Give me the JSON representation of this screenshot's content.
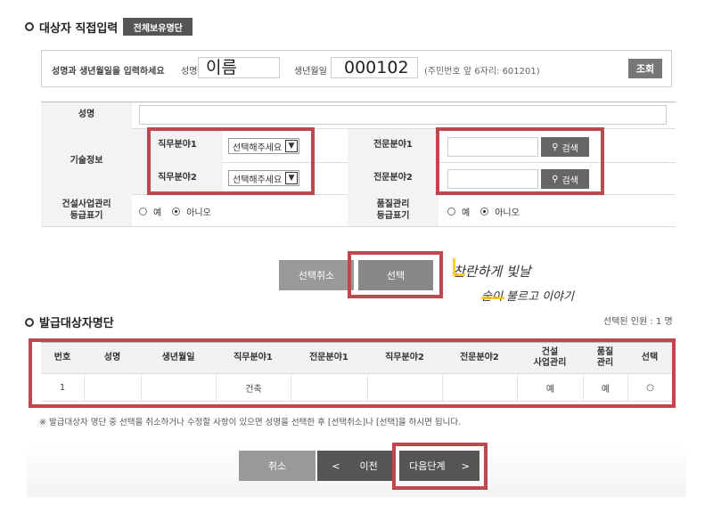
{
  "direct_input": {
    "section_title": "대상자 직접입력",
    "all_holders_button": "전체보유명단"
  },
  "lookup": {
    "prompt": "성명과 생년월일을 입력하세요",
    "name_label": "성명",
    "name_value": "이름",
    "birth_label": "생년월일",
    "birth_value": "000102",
    "birth_hint": "(주민번호 앞 6자리: 601201)",
    "lookup_button": "조회"
  },
  "form": {
    "name_label": "성명",
    "tech_info_label": "기술정보",
    "job_field1_label": "직무분야1",
    "job_field2_label": "직무분야2",
    "select_placeholder": "선택해주세요",
    "specialty1_label": "전문분야1",
    "specialty2_label": "전문분야2",
    "search_button": "검색",
    "construction_grade_label_1": "건설사업관리",
    "construction_grade_label_2": "등급표기",
    "quality_grade_label_1": "품질관리",
    "quality_grade_label_2": "등급표기",
    "yes": "예",
    "no": "아니오"
  },
  "actions": {
    "cancel_selection": "선택취소",
    "select": "선택"
  },
  "handwriting": {
    "line1": "찬란하게 빛날",
    "line2": "술이 불르고 이야기"
  },
  "issue_list": {
    "section_title": "발급대상자명단",
    "selected_count": "선택된 인원 : 1 명",
    "columns": [
      "번호",
      "성명",
      "생년월일",
      "직무분야1",
      "전문분야1",
      "직무분야2",
      "전문분야2",
      "건설\n사업관리",
      "품질\n관리",
      "선택"
    ],
    "rows": [
      {
        "no": "1",
        "name": "",
        "birth": "",
        "job1": "건축",
        "spec1": "",
        "job2": "",
        "spec2": "",
        "construction": "예",
        "quality": "예",
        "select": "○"
      }
    ],
    "note": "※ 발급대상자 명단 중 선택을 취소하거나 수정할 사항이 있으면 성명을 선택한 후 [선택취소]나 [선택]을 하시면 됩니다."
  },
  "nav": {
    "cancel": "취소",
    "prev_arrow": "<",
    "prev": "이전",
    "next": "다음단계",
    "next_arrow": ">"
  },
  "colors": {
    "highlight_red": "#c0474e",
    "dark_button": "#555555",
    "select_button": "#888888",
    "handwriting_yellow": "#f5c400"
  }
}
